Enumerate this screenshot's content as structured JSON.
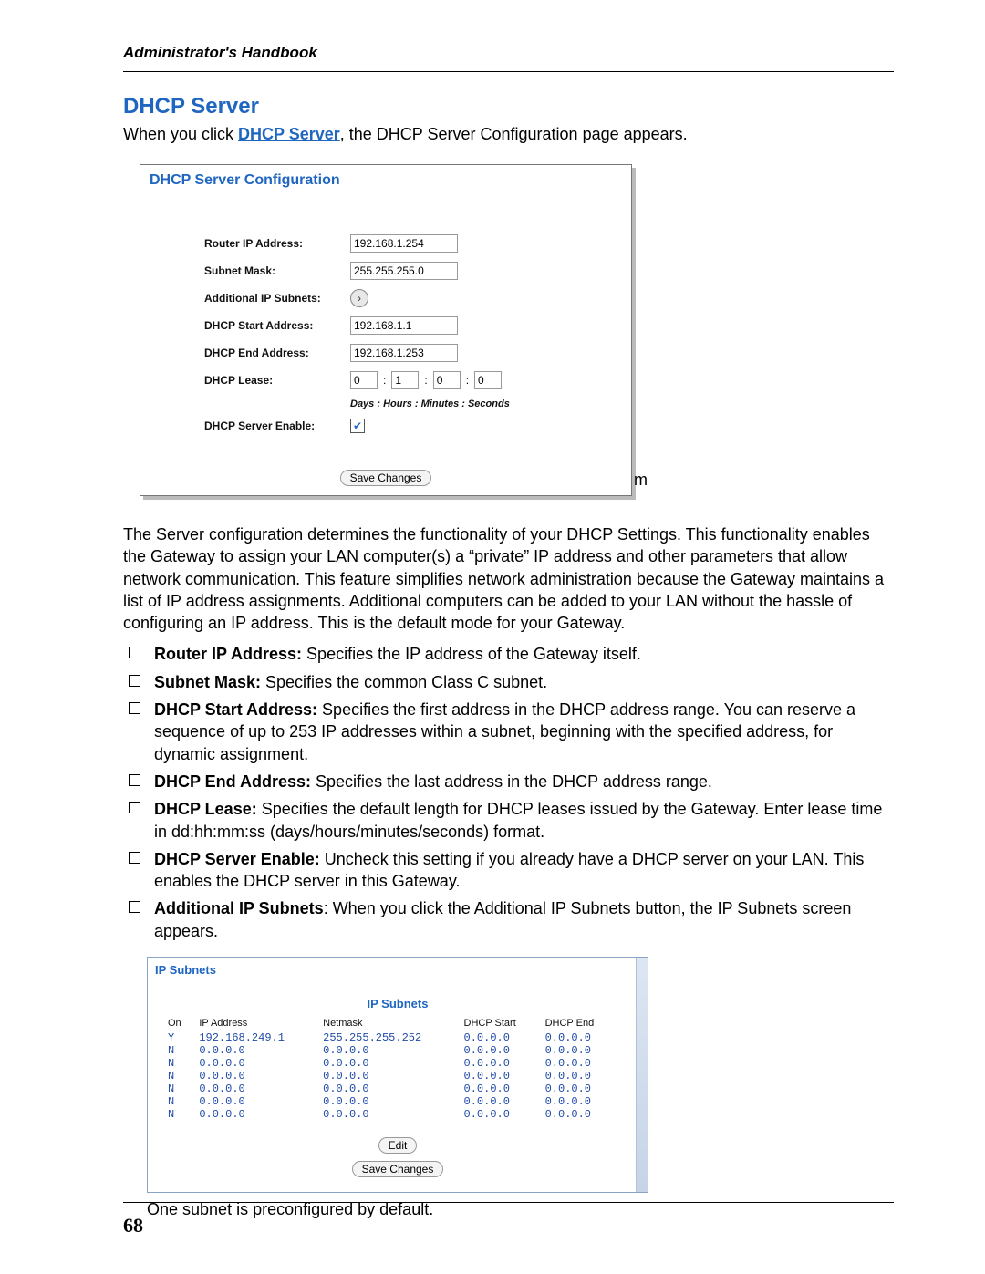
{
  "header": {
    "title": "Administrator's Handbook"
  },
  "section": {
    "title": "DHCP Server",
    "intro_before": "When you click ",
    "intro_link": "DHCP Server",
    "intro_after": ", the DHCP Server Configuration page appears."
  },
  "config_panel": {
    "title": "DHCP Server Configuration",
    "labels": {
      "router_ip": "Router IP Address:",
      "subnet_mask": "Subnet Mask:",
      "additional_subnets": "Additional IP Subnets:",
      "dhcp_start": "DHCP Start Address:",
      "dhcp_end": "DHCP End Address:",
      "dhcp_lease": "DHCP Lease:",
      "server_enable": "DHCP Server Enable:"
    },
    "values": {
      "router_ip": "192.168.1.254",
      "subnet_mask": "255.255.255.0",
      "dhcp_start": "192.168.1.1",
      "dhcp_end": "192.168.1.253",
      "lease_days": "0",
      "lease_hours": "1",
      "lease_minutes": "0",
      "lease_seconds": "0"
    },
    "lease_caption": "Days : Hours : Minutes : Seconds",
    "save_label": "Save Changes",
    "m_label": "m"
  },
  "body": {
    "paragraph": "The Server configuration determines the functionality of your DHCP Settings. This functionality enables the Gateway to assign your LAN computer(s) a “private” IP address and other parameters that allow network communication. This feature simplifies network administration because the Gateway maintains a list of IP address assignments. Additional computers can be added to your LAN without the hassle of configuring an IP address. This is the default mode for your Gateway.",
    "bullets": [
      {
        "bold": "Router IP Address:",
        "text": " Specifies the IP address of the Gateway itself."
      },
      {
        "bold": "Subnet Mask:",
        "text": " Specifies the common Class C subnet."
      },
      {
        "bold": "DHCP Start Address:",
        "text": " Specifies the first address in the DHCP address range. You can reserve a sequence of up to 253 IP addresses within a subnet, beginning with the specified address, for dynamic assignment."
      },
      {
        "bold": "DHCP End Address:",
        "text": " Specifies the last address in the DHCP address range."
      },
      {
        "bold": "DHCP Lease:",
        "text": " Specifies the default length for DHCP leases issued by the Gateway. Enter lease time in dd:hh:mm:ss (days/hours/minutes/seconds) format."
      },
      {
        "bold": "DHCP Server Enable:",
        "text": " Uncheck this setting if you already have a DHCP server on your LAN. This enables the DHCP server in this Gateway."
      },
      {
        "bold": "Additional IP Subnets",
        "text": ": When you click the Additional IP Subnets button, the IP Subnets screen appears."
      }
    ]
  },
  "subnets_panel": {
    "title": "IP Subnets",
    "heading": "IP Subnets",
    "columns": [
      "On",
      "IP Address",
      "Netmask",
      "DHCP Start",
      "DHCP End"
    ],
    "rows": [
      {
        "on": "Y",
        "ip": "192.168.249.1",
        "mask": "255.255.255.252",
        "start": "0.0.0.0",
        "end": "0.0.0.0"
      },
      {
        "on": "N",
        "ip": "0.0.0.0",
        "mask": "0.0.0.0",
        "start": "0.0.0.0",
        "end": "0.0.0.0"
      },
      {
        "on": "N",
        "ip": "0.0.0.0",
        "mask": "0.0.0.0",
        "start": "0.0.0.0",
        "end": "0.0.0.0"
      },
      {
        "on": "N",
        "ip": "0.0.0.0",
        "mask": "0.0.0.0",
        "start": "0.0.0.0",
        "end": "0.0.0.0"
      },
      {
        "on": "N",
        "ip": "0.0.0.0",
        "mask": "0.0.0.0",
        "start": "0.0.0.0",
        "end": "0.0.0.0"
      },
      {
        "on": "N",
        "ip": "0.0.0.0",
        "mask": "0.0.0.0",
        "start": "0.0.0.0",
        "end": "0.0.0.0"
      },
      {
        "on": "N",
        "ip": "0.0.0.0",
        "mask": "0.0.0.0",
        "start": "0.0.0.0",
        "end": "0.0.0.0"
      }
    ],
    "edit_label": "Edit",
    "save_label": "Save Changes"
  },
  "after_note": "One subnet is preconfigured by default.",
  "page_number": "68"
}
